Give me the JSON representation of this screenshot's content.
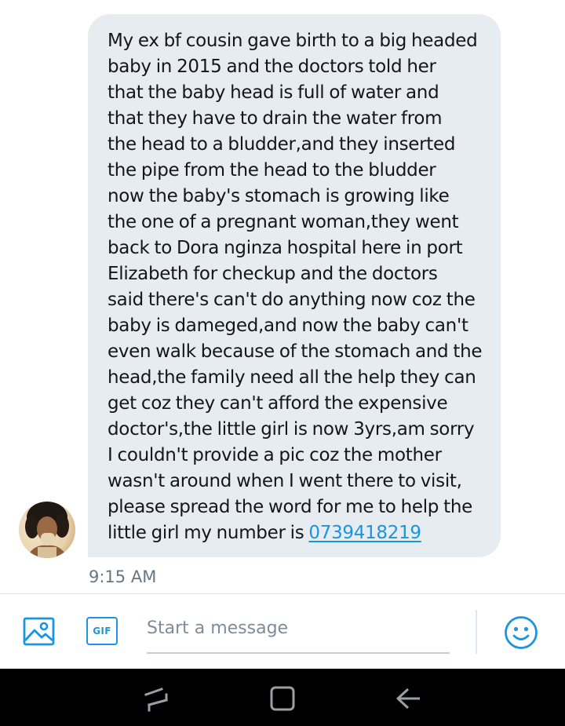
{
  "conversation": {
    "message": {
      "lines": [
        "My ex bf cousin gave birth to a big headed",
        "baby in 2015 and the doctors told her",
        "that the baby head is full of water and",
        "that they have to drain the water from",
        "the head to a bludder,and they inserted",
        "the pipe from the head to the bludder",
        "now the baby's stomach is growing like",
        "the one of a pregnant woman,they went",
        "back to Dora nginza hospital here in port",
        "Elizabeth for checkup and the doctors",
        "said there's can't do anything now coz the",
        "baby is dameged,and now the baby can't",
        "even walk because of the stomach and the",
        "head,the family need all the help they can",
        "get coz they can't afford the expensive",
        "doctor's,the little girl is now 3yrs,am sorry",
        "I couldn't provide a pic coz the mother",
        "wasn't around when I went there to visit,",
        "please spread the word for me to help the"
      ],
      "last_line_prefix": "little girl my number is ",
      "phone_number": "0739418219",
      "timestamp": "9:15 AM"
    }
  },
  "composer": {
    "placeholder": "Start a message",
    "gif_label": "GIF",
    "icons": {
      "image": "image-icon",
      "gif": "gif-icon",
      "emoji": "emoji-icon"
    }
  },
  "navigation_bar": {
    "icons": [
      "recent-apps-icon",
      "home-icon",
      "back-icon"
    ]
  },
  "colors": {
    "bubble": "#e6ecf0",
    "accent": "#1b95e0",
    "text": "#14171a",
    "muted": "#657786"
  }
}
